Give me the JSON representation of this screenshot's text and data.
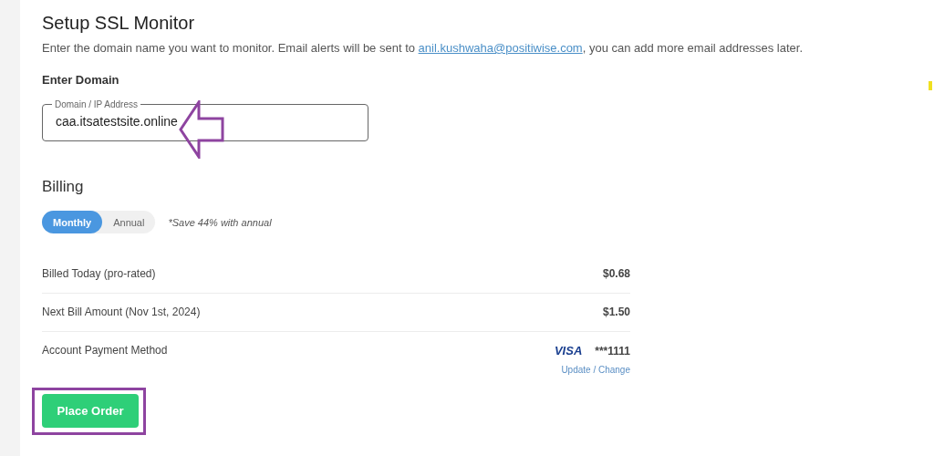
{
  "title": "Setup SSL Monitor",
  "intro": {
    "before": "Enter the domain name you want to monitor. Email alerts will be sent to ",
    "email": "anil.kushwaha@positiwise.com",
    "after": ", you can add more email addresses later."
  },
  "domain": {
    "heading": "Enter Domain",
    "label": "Domain / IP Address",
    "value": "caa.itsatestsite.online"
  },
  "billing": {
    "heading": "Billing",
    "periods": [
      {
        "label": "Monthly",
        "selected": true
      },
      {
        "label": "Annual",
        "selected": false
      }
    ],
    "note": "*Save 44% with annual",
    "rows": [
      {
        "label": "Billed Today (pro-rated)",
        "value": "$0.68"
      },
      {
        "label": "Next Bill Amount (Nov 1st, 2024)",
        "value": "$1.50"
      }
    ],
    "payment": {
      "label": "Account Payment Method",
      "brand": "VISA",
      "card": "***1111",
      "link": "Update / Change"
    }
  },
  "button": "Place Order"
}
